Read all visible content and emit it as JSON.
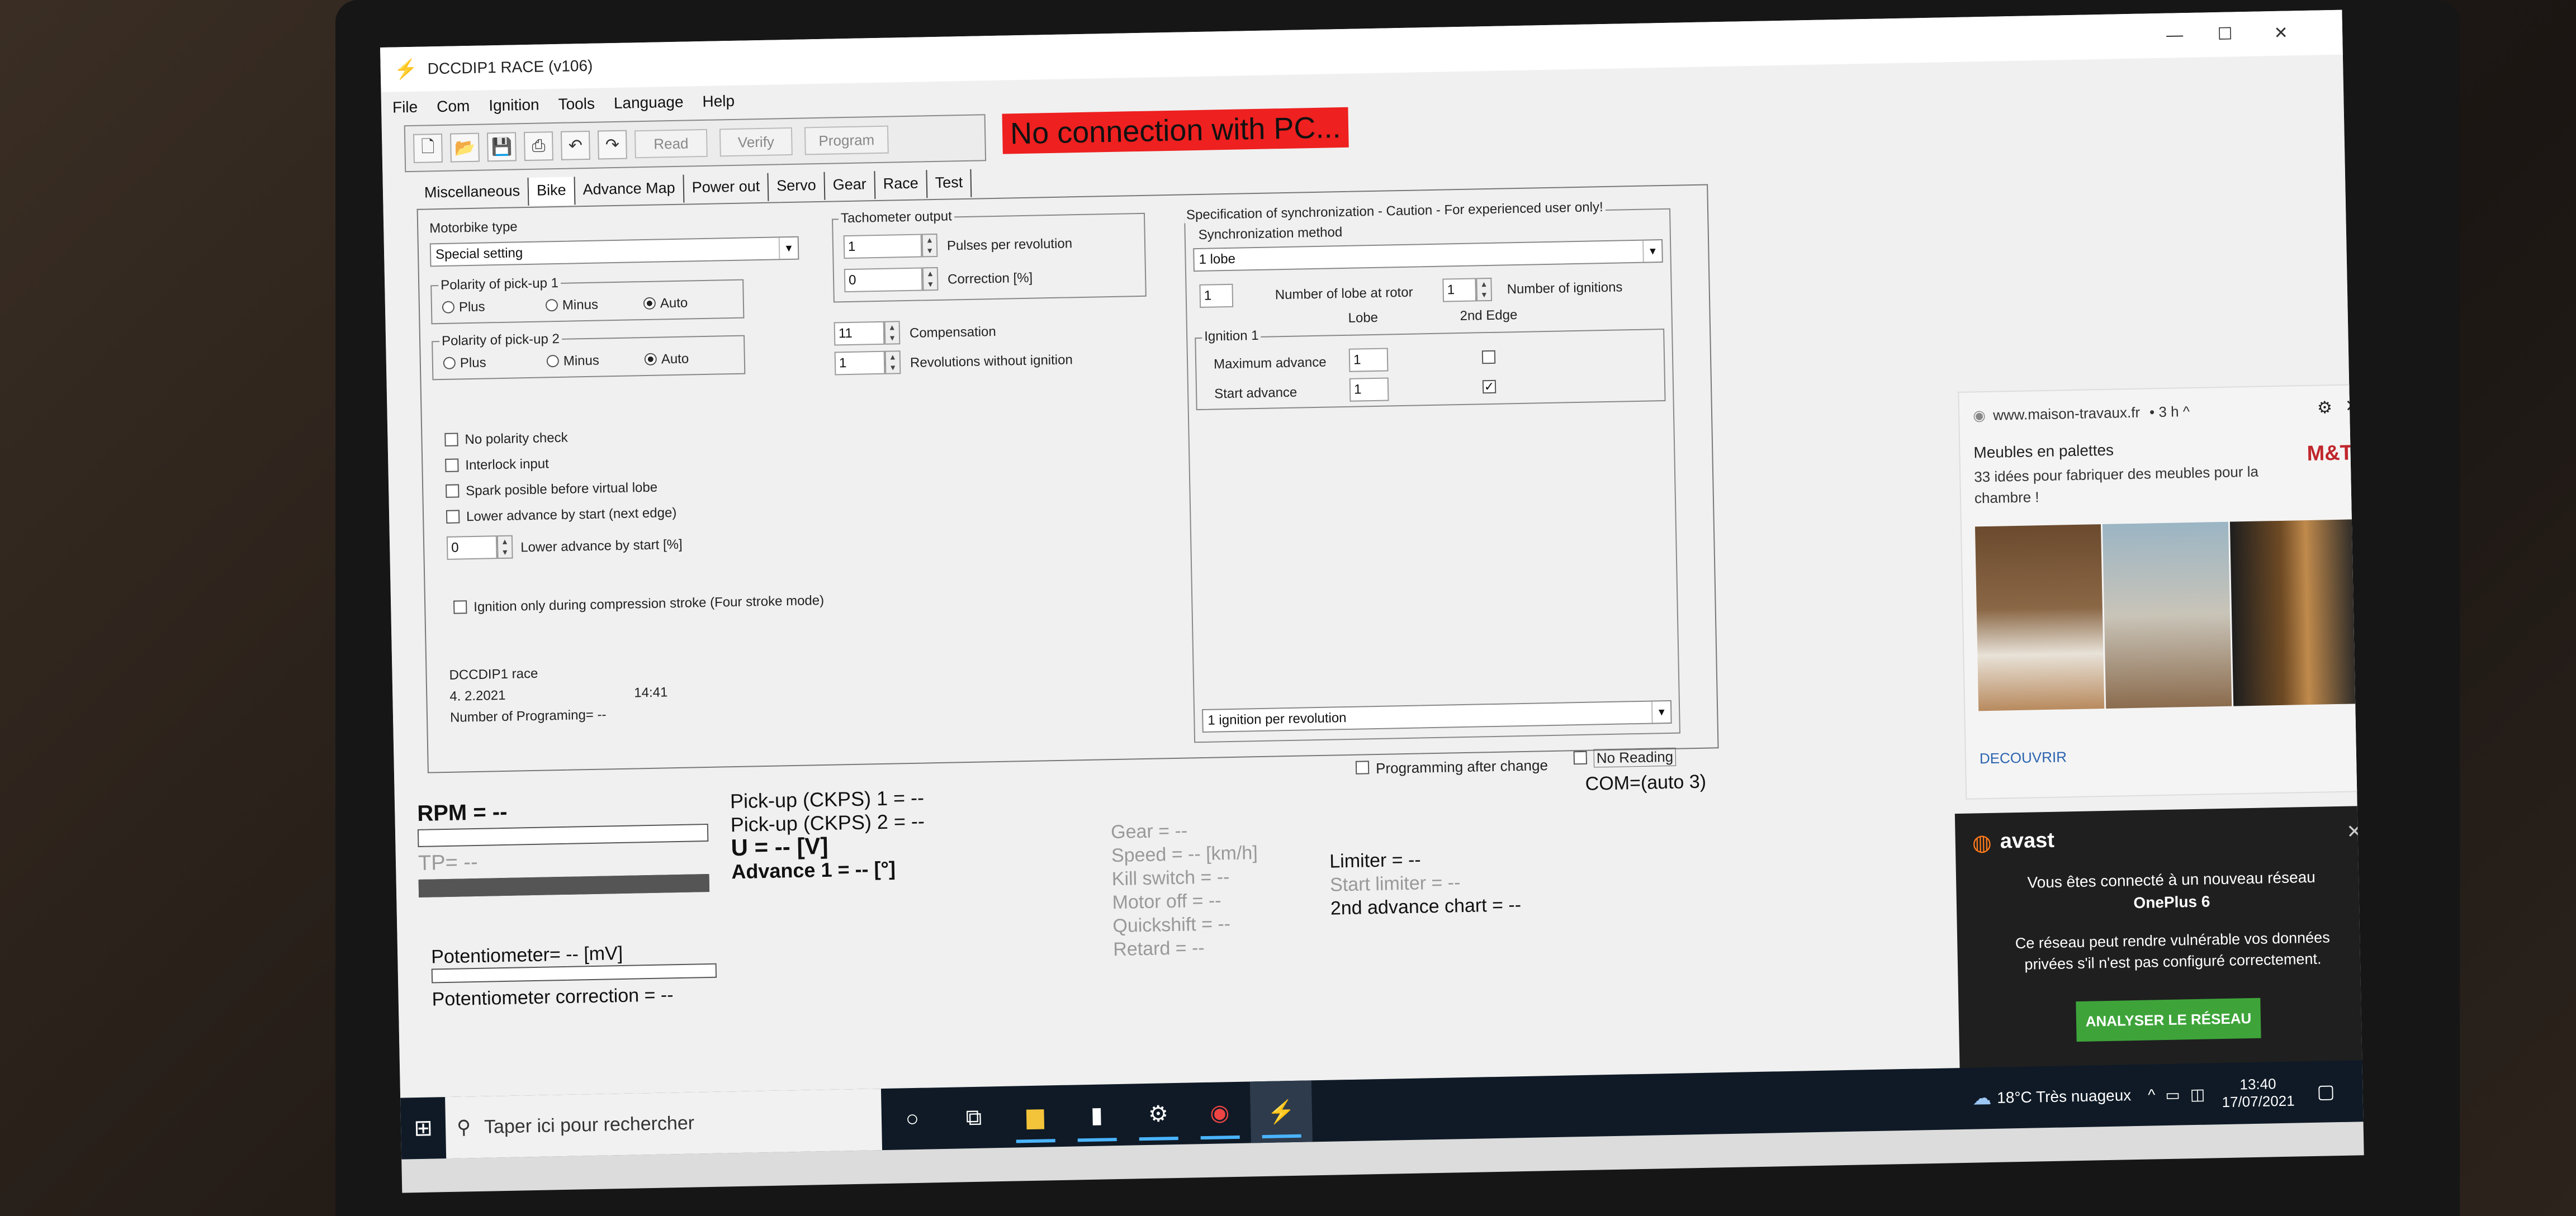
{
  "window": {
    "title": "DCCDIP1 RACE (v106)"
  },
  "menu": [
    "File",
    "Com",
    "Ignition",
    "Tools",
    "Language",
    "Help"
  ],
  "toolbar": {
    "read": "Read",
    "verify": "Verify",
    "program": "Program"
  },
  "status_banner": "No connection with PC...",
  "tabs": [
    "Miscellaneous",
    "Bike",
    "Advance Map",
    "Power out",
    "Servo",
    "Gear",
    "Race",
    "Test"
  ],
  "bike": {
    "motorbike_type_label": "Motorbike type",
    "motorbike_type_value": "Special setting",
    "pickup1": {
      "title": "Polarity of pick-up 1",
      "plus": "Plus",
      "minus": "Minus",
      "auto": "Auto"
    },
    "pickup2": {
      "title": "Polarity of pick-up 2",
      "plus": "Plus",
      "minus": "Minus",
      "auto": "Auto"
    },
    "tacho": {
      "title": "Tachometer output",
      "pulses_value": "1",
      "pulses_label": "Pulses per revolution",
      "correction_value": "0",
      "correction_label": "Correction [%]"
    },
    "compensation_value": "11",
    "compensation_label": "Compensation",
    "rev_without_value": "1",
    "rev_without_label": "Revolutions without ignition",
    "checks": [
      "No polarity check",
      "Interlock input",
      "Spark posible before virtual lobe",
      "Lower advance by start (next edge)"
    ],
    "lower_adv_value": "0",
    "lower_adv_label": "Lower advance by start [%]",
    "ign_only": "Ignition only during compression stroke (Four stroke mode)",
    "info_name": "DCCDIP1 race",
    "info_date": "4. 2.2021",
    "info_time": "14:41",
    "info_prog": "Number of Programing= --"
  },
  "sync": {
    "title": "Specification of synchronization - Caution - For experienced user only!",
    "method_label": "Synchronization method",
    "method_value": "1 lobe",
    "lobe_value": "1",
    "lobe_label": "Number of lobe at rotor",
    "ign_value": "1",
    "ign_label": "Number of ignitions",
    "lobe_header": "Lobe",
    "edge_header": "2nd Edge",
    "ign1_title": "Ignition 1",
    "max_adv_label": "Maximum advance",
    "max_adv_value": "1",
    "start_adv_label": "Start advance",
    "start_adv_value": "1",
    "bottom_select": "1 ignition per revolution"
  },
  "bottom": {
    "prog_after_change": "Programming after change",
    "no_reading": "No Reading",
    "com": "COM=(auto 3)",
    "rpm": "RPM = --",
    "tp": "TP= --",
    "pickup1": "Pick-up (CKPS) 1 = --",
    "pickup2": "Pick-up (CKPS) 2 = --",
    "voltage": "U = -- [V]",
    "advance": "Advance 1 = -- [°]",
    "gear": "Gear = --",
    "speed": "Speed = -- [km/h]",
    "kill": "Kill switch = --",
    "motor_off": "Motor off = --",
    "quickshift": "Quickshift = --",
    "retard": "Retard = --",
    "limiter": "Limiter = --",
    "start_limiter": "Start limiter = --",
    "second_chart": "2nd advance chart = --",
    "potentiometer": "Potentiometer= -- [mV]",
    "pot_correction": "Potentiometer correction = --"
  },
  "notification1": {
    "source": "www.maison-travaux.fr",
    "age": "• 3 h ^",
    "title": "Meubles en palettes",
    "body": "33 idées pour fabriquer des meubles pour la chambre !",
    "logo": "M&T",
    "action": "DECOUVRIR"
  },
  "notification2": {
    "brand": "avast",
    "line1": "Vous êtes connecté à un nouveau réseau",
    "network": "OnePlus 6",
    "line2": "Ce réseau peut rendre vulnérable vos données privées s'il n'est pas configuré correctement.",
    "button": "ANALYSER LE RÉSEAU"
  },
  "taskbar": {
    "search_placeholder": "Taper ici pour rechercher",
    "weather": "18°C Très nuageux",
    "time": "13:40",
    "date": "17/07/2021"
  }
}
